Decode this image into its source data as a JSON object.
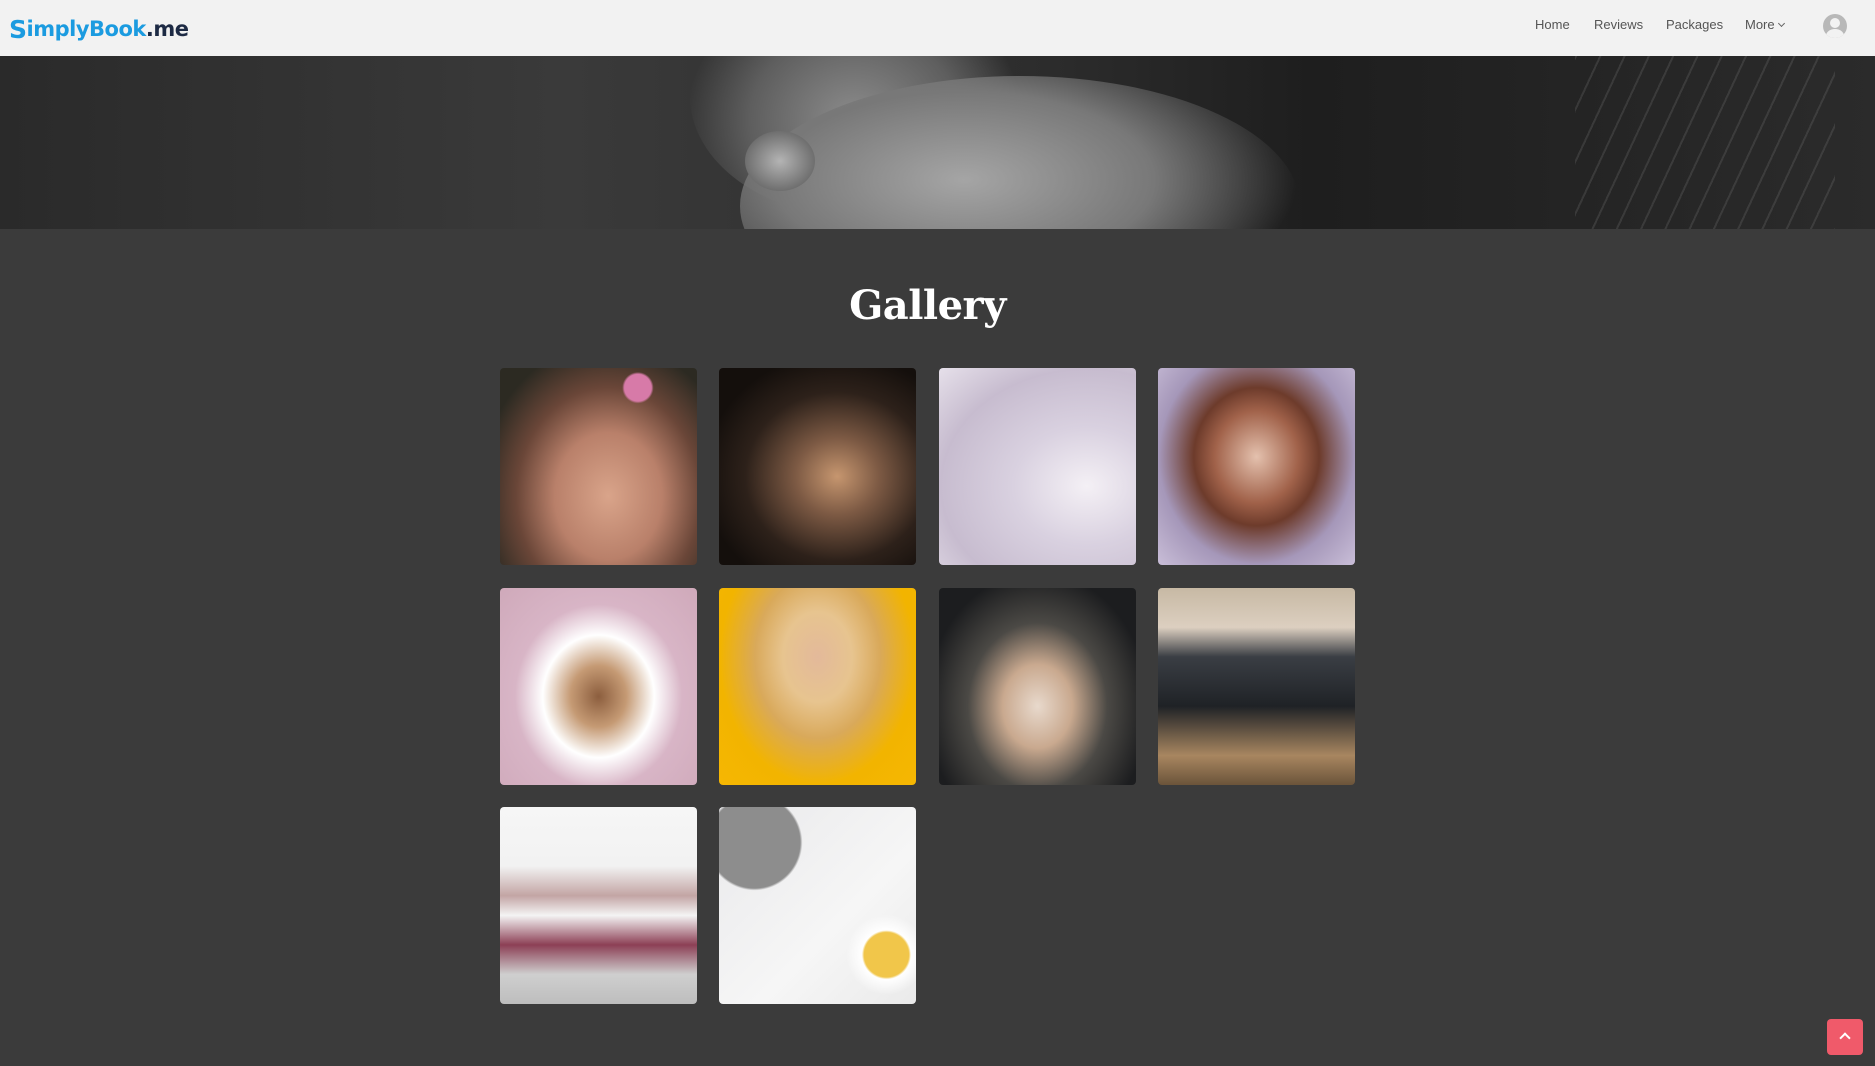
{
  "brand": {
    "logo_first": "S",
    "logo_mid": "implyBook",
    "logo_suffix": ".me"
  },
  "nav": {
    "home": "Home",
    "reviews": "Reviews",
    "packages": "Packages",
    "more": "More"
  },
  "gallery": {
    "title": "Gallery",
    "images": [
      {
        "icon": "photo-woman-with-flowers"
      },
      {
        "icon": "photo-hands-with-dropper-bottle"
      },
      {
        "icon": "photo-makeup-brushes-cup"
      },
      {
        "icon": "photo-woman-portrait"
      },
      {
        "icon": "photo-woman-long-hair-back"
      },
      {
        "icon": "photo-blonde-woman-yellow-background"
      },
      {
        "icon": "photo-hands-in-water"
      },
      {
        "icon": "photo-makeup-brushes-case"
      },
      {
        "icon": "photo-salon-interior"
      },
      {
        "icon": "photo-tea-on-marble"
      }
    ]
  },
  "colors": {
    "accent": "#f05a6a",
    "brand": "#1b9be0",
    "background": "#3b3b3b"
  }
}
